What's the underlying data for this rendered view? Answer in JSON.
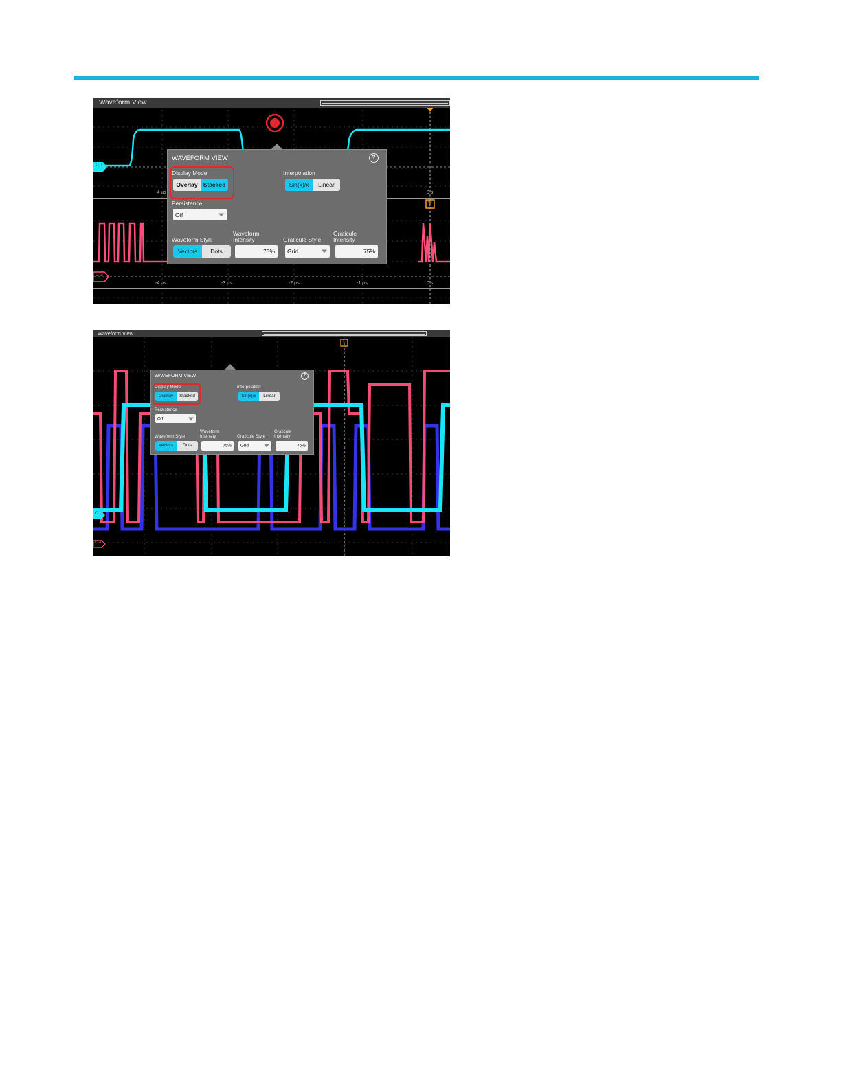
{
  "screenshots": [
    {
      "view_label": "Waveform View",
      "panel": {
        "title": "WAVEFORM VIEW",
        "help_icon": "help-icon",
        "display_mode": {
          "label": "Display Mode",
          "options": [
            "Overlay",
            "Stacked"
          ],
          "selected": "Stacked"
        },
        "interpolation": {
          "label": "Interpolation",
          "options": [
            "Sin(x)/x",
            "Linear"
          ],
          "selected": "Sin(x)/x"
        },
        "persistence": {
          "label": "Persistence",
          "value": "Off"
        },
        "waveform_style": {
          "label": "Waveform Style",
          "options": [
            "Vectors",
            "Dots"
          ],
          "selected": "Vectors"
        },
        "waveform_intensity": {
          "label_line1": "Waveform",
          "label_line2": "Intensity",
          "value": "75%"
        },
        "graticule_style": {
          "label": "Graticule Style",
          "value": "Grid"
        },
        "graticule_intensity": {
          "label_line1": "Graticule",
          "label_line2": "Intensity",
          "value": "75%"
        }
      },
      "time_ticks_upper": [
        "-4 µs",
        "0 s"
      ],
      "time_ticks_lower": [
        "-4 µs",
        "-3 µs",
        "-2 µs",
        "-1 µs",
        "0 s"
      ],
      "trigger_marker": "T",
      "channel_badges": [
        "C 1",
        "C 3"
      ]
    },
    {
      "view_label": "Waveform View",
      "panel": {
        "title": "WAVEFORM VIEW",
        "help_icon": "help-icon",
        "display_mode": {
          "label": "Display Mode",
          "options": [
            "Overlay",
            "Stacked"
          ],
          "selected": "Overlay"
        },
        "interpolation": {
          "label": "Interpolation",
          "options": [
            "Sin(x)/x",
            "Linear"
          ],
          "selected": "Sin(x)/x"
        },
        "persistence": {
          "label": "Persistence",
          "value": "Off"
        },
        "waveform_style": {
          "label": "Waveform Style",
          "options": [
            "Vectors",
            "Dots"
          ],
          "selected": "Vectors"
        },
        "waveform_intensity": {
          "label_line1": "Waveform",
          "label_line2": "Intensity",
          "value": "75%"
        },
        "graticule_style": {
          "label": "Graticule Style",
          "value": "Grid"
        },
        "graticule_intensity": {
          "label_line1": "Graticule",
          "label_line2": "Intensity",
          "value": "75%"
        }
      },
      "trigger_marker": "T",
      "channel_badges": [
        "C 1",
        "C 3"
      ]
    }
  ],
  "colors": {
    "accent": "#1ab0d8",
    "ch1": "#19e6f5",
    "ch3": "#ff4f7a",
    "ch4": "#3a3aff",
    "trigger": "#f0a030",
    "highlight": "#e0282d",
    "selected_button": "#19c8ef"
  }
}
